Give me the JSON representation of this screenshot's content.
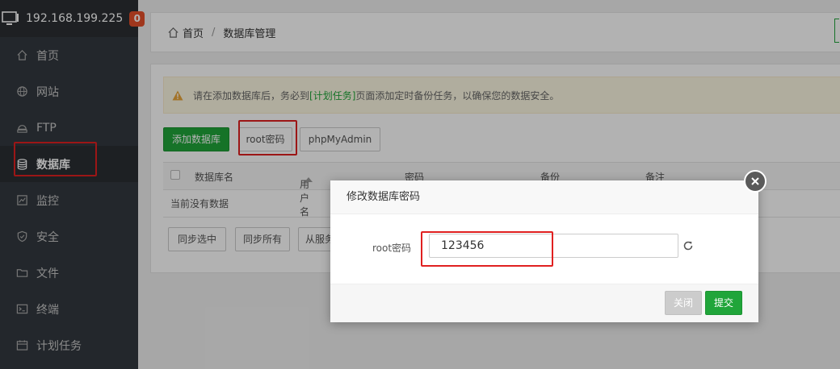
{
  "sidebar": {
    "ip": "192.168.199.225",
    "badge": "0",
    "items": [
      {
        "label": "首页",
        "icon": "home-icon"
      },
      {
        "label": "网站",
        "icon": "globe-icon"
      },
      {
        "label": "FTP",
        "icon": "ftp-icon"
      },
      {
        "label": "数据库",
        "icon": "database-icon",
        "active": true
      },
      {
        "label": "监控",
        "icon": "monitor-chart-icon"
      },
      {
        "label": "安全",
        "icon": "shield-icon"
      },
      {
        "label": "文件",
        "icon": "folder-icon"
      },
      {
        "label": "终端",
        "icon": "terminal-icon"
      },
      {
        "label": "计划任务",
        "icon": "calendar-icon"
      }
    ]
  },
  "breadcrumb": {
    "home": "首页",
    "separator": "/",
    "current": "数据库管理"
  },
  "alert": {
    "text_before": "请在添加数据库后，务必到",
    "link": "[计划任务]",
    "text_after": "页面添加定时备份任务，以确保您的数据安全。"
  },
  "toolbar": {
    "add_db": "添加数据库",
    "root_password": "root密码",
    "phpmyadmin": "phpMyAdmin"
  },
  "table": {
    "columns": [
      "数据库名",
      "用户名",
      "密码",
      "备份",
      "备注"
    ],
    "empty_text": "当前没有数据"
  },
  "bottom_buttons": {
    "sync_selected": "同步选中",
    "sync_all": "同步所有",
    "from_server": "从服务"
  },
  "modal": {
    "title": "修改数据库密码",
    "field_label": "root密码",
    "field_value": "123456",
    "close": "关闭",
    "submit": "提交"
  },
  "colors": {
    "primary_green": "#20a53a",
    "sidebar_bg": "#33393f",
    "badge": "#e6502a",
    "highlight_red": "#e02020"
  }
}
